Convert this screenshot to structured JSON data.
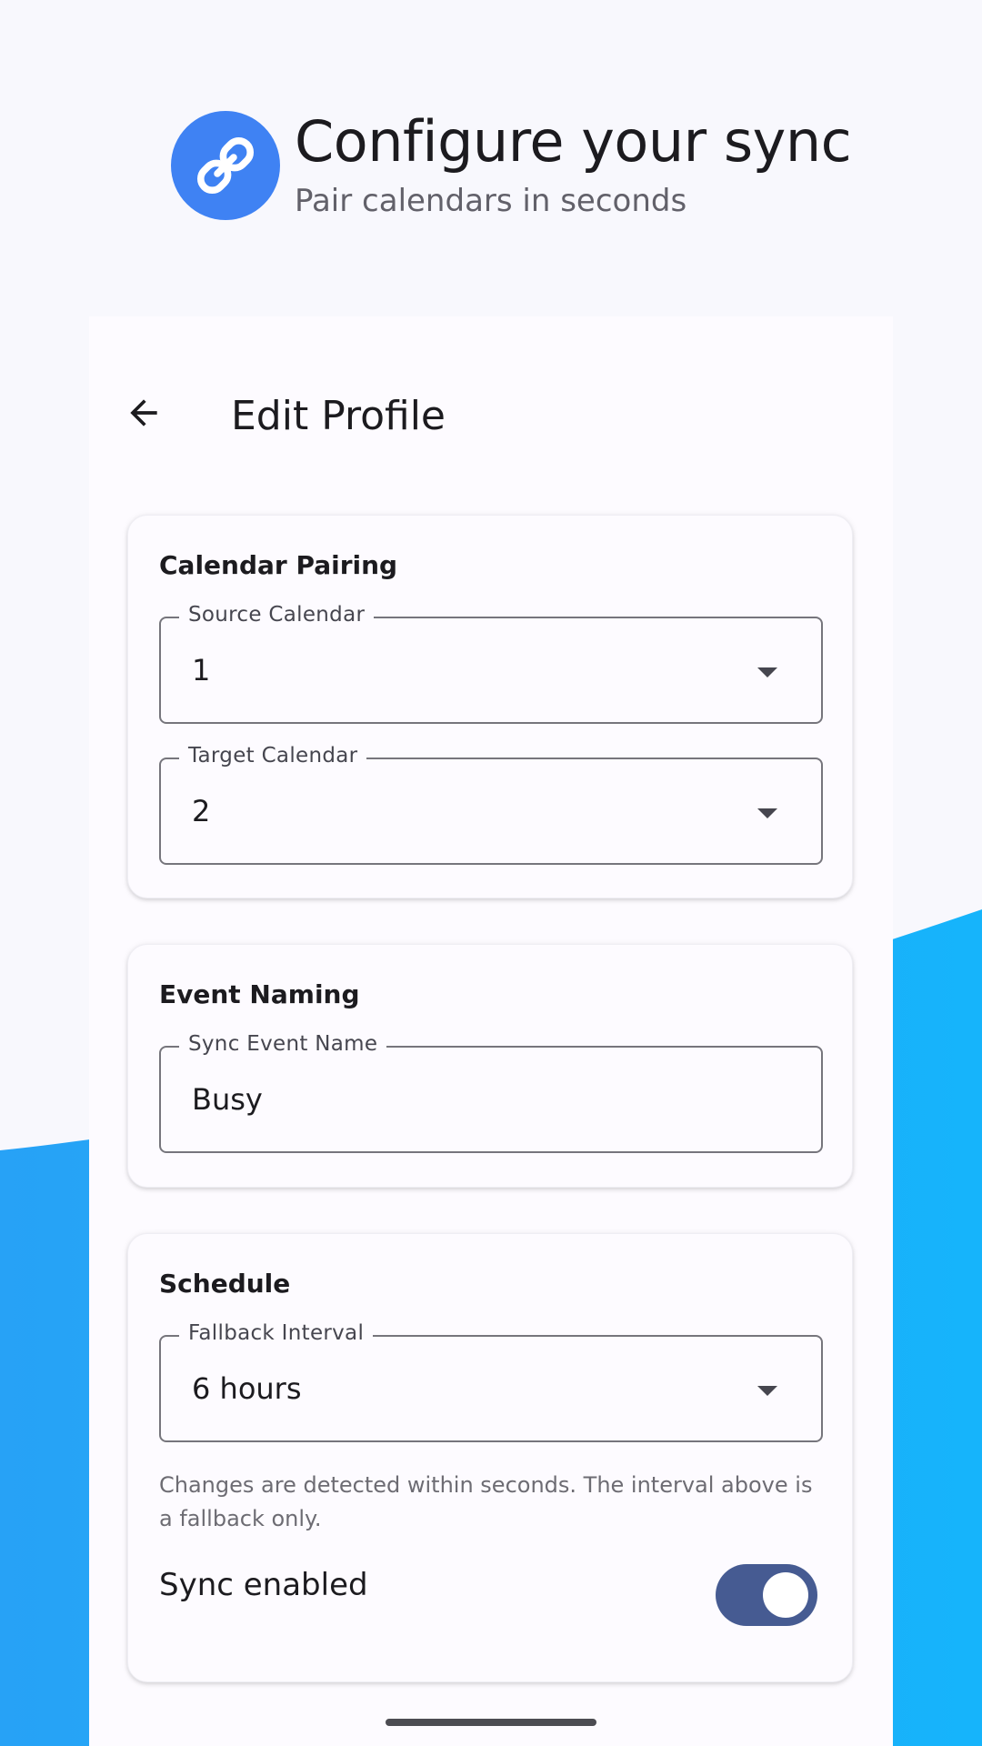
{
  "hero": {
    "title": "Configure your sync",
    "subtitle": "Pair calendars in seconds",
    "icon": "link-icon",
    "badge_color": "#3f82f3"
  },
  "appbar": {
    "title": "Edit Profile",
    "back_icon": "arrow-left-icon"
  },
  "cards": {
    "pairing": {
      "title": "Calendar Pairing",
      "source": {
        "label": "Source Calendar",
        "value": "1"
      },
      "target": {
        "label": "Target Calendar",
        "value": "2"
      }
    },
    "naming": {
      "title": "Event Naming",
      "event_name": {
        "label": "Sync Event Name",
        "value": "Busy"
      }
    },
    "schedule": {
      "title": "Schedule",
      "interval": {
        "label": "Fallback Interval",
        "value": "6 hours"
      },
      "helper": "Changes are detected within seconds. The interval above is a fallback only.",
      "toggle_label": "Sync enabled",
      "toggle_on": true
    }
  },
  "colors": {
    "accent_blue": "#1fa9f8",
    "switch_track": "#465b92",
    "background": "#f8f8fd"
  }
}
